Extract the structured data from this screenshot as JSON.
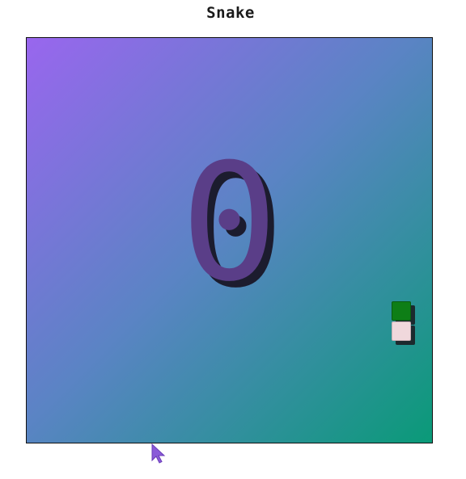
{
  "game": {
    "title": "Snake",
    "score": "0"
  },
  "colors": {
    "gradient_start": "#9966ee",
    "gradient_end": "#0a9a78",
    "score_color": "#5a3e88",
    "food_color": "#0e7e16",
    "snake_color": "#f0d8dc",
    "cursor_color": "#8a5ad8"
  },
  "icons": {
    "cursor": "mouse-pointer-icon"
  }
}
